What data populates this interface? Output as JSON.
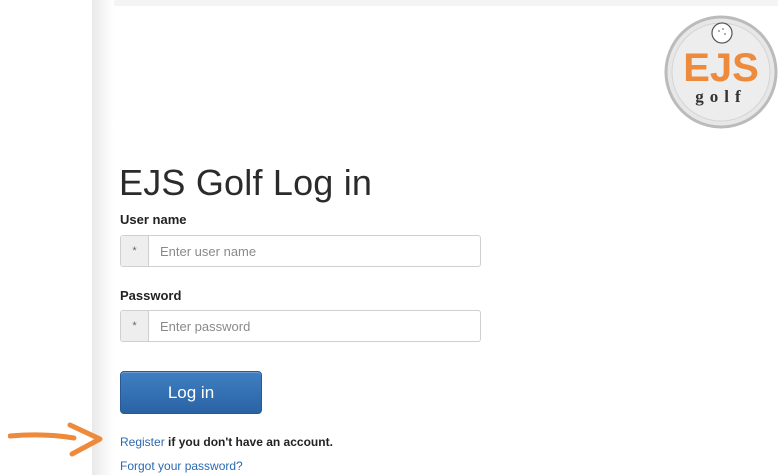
{
  "logo": {
    "letters": "EJS",
    "sub": "golf",
    "ring_color": "#bbbbbb",
    "accent": "#ee8a3c"
  },
  "page": {
    "title": "EJS Golf Log in"
  },
  "form": {
    "username": {
      "label": "User name",
      "required_mark": "*",
      "placeholder": "Enter user name",
      "value": ""
    },
    "password": {
      "label": "Password",
      "required_mark": "*",
      "placeholder": "Enter password",
      "value": ""
    },
    "submit_label": "Log in"
  },
  "footer": {
    "register_link": "Register",
    "register_text": "if you don't have an account.",
    "forgot_link": "Forgot your password?"
  },
  "annotation": {
    "arrow_color": "#ee8a3c",
    "points_to": "register-link"
  },
  "colors": {
    "primary_button": "#2f6db0",
    "link": "#2a6ab0"
  }
}
